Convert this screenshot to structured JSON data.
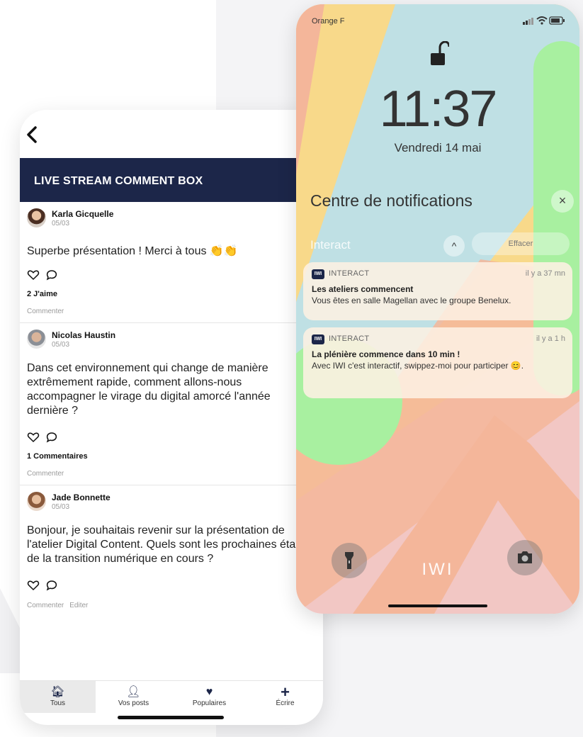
{
  "feed": {
    "header_title": "LIVE STREAM COMMENT BOX",
    "posts": [
      {
        "author": "Karla Gicquelle",
        "date": "05/03",
        "text": "Superbe présentation ! Merci à tous 👏👏",
        "stat": "2 J'aime",
        "comment_label": "Commenter"
      },
      {
        "author": "Nicolas Haustin",
        "date": "05/03",
        "text": "Dans cet environnement qui change de manière extrêmement rapide, comment allons-nous accompagner le virage du digital amorcé l'année dernière ?",
        "stat": "1 Commentaires",
        "comment_label": "Commenter"
      },
      {
        "author": "Jade Bonnette",
        "date": "05/03",
        "text": "Bonjour, je souhaitais revenir sur la présentation de l'atelier Digital Content. Quels sont les prochaines étapes de la transition numérique en cours ?",
        "comment_label": "Commenter",
        "edit_label": "Editer"
      }
    ],
    "tabs": [
      {
        "label": "Tous",
        "icon": "home-icon",
        "glyph": "🏠︎"
      },
      {
        "label": "Vos posts",
        "icon": "user-icon",
        "glyph": "👤︎"
      },
      {
        "label": "Populaires",
        "icon": "heart-icon",
        "glyph": "♥"
      },
      {
        "label": "Écrire",
        "icon": "plus-icon",
        "glyph": "+"
      }
    ]
  },
  "lockscreen": {
    "carrier": "Orange F",
    "time": "11:37",
    "date": "Vendredi 14 mai",
    "notification_center_title": "Centre de notifications",
    "close_glyph": "×",
    "group_label": "Interact",
    "collapse_glyph": "^",
    "clear_label": "Effacer",
    "brand": "IWI",
    "notifications": [
      {
        "app_icon_text": "IWI",
        "app": "INTERACT",
        "time": "il y a 37 mn",
        "title": "Les ateliers commencent",
        "body": "Vous êtes en salle Magellan avec le groupe Benelux."
      },
      {
        "app_icon_text": "IWI",
        "app": "INTERACT",
        "time": "il y a 1 h",
        "title": "La plénière commence dans 10 min !",
        "body": "Avec IWI c'est interactif, swippez-moi pour participer 😊."
      }
    ]
  },
  "colors": {
    "header_navy": "#1c2649",
    "lock_yellow": "#f8d98a",
    "lock_blue": "#bfe0e4",
    "lock_peach": "#f4b69a",
    "lock_green": "#a8f0a0",
    "lock_pink": "#f2c7c4"
  }
}
